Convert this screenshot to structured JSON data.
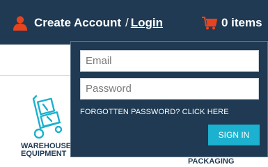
{
  "header": {
    "create_account_label": "Create Account",
    "separator": "/",
    "login_label": "Login",
    "cart_count": "0 items",
    "user_icon": "user-icon",
    "cart_icon": "shopping-cart-icon",
    "accent_color": "#e8431f"
  },
  "login_form": {
    "email_placeholder": "Email",
    "password_placeholder": "Password",
    "forgot_password_link": "FORGOTTEN PASSWORD? CLICK HERE",
    "sign_in_button": "SIGN IN",
    "button_color": "#1bb1cf"
  },
  "categories": [
    {
      "label_line1": "WAREHOUSE",
      "label_line2": "EQUIPMENT",
      "icon": "hand-truck-icon"
    },
    {
      "label": "PACKAGING"
    }
  ],
  "colors": {
    "header_bg": "#1f3a52",
    "icon_teal": "#1bb1cf"
  }
}
